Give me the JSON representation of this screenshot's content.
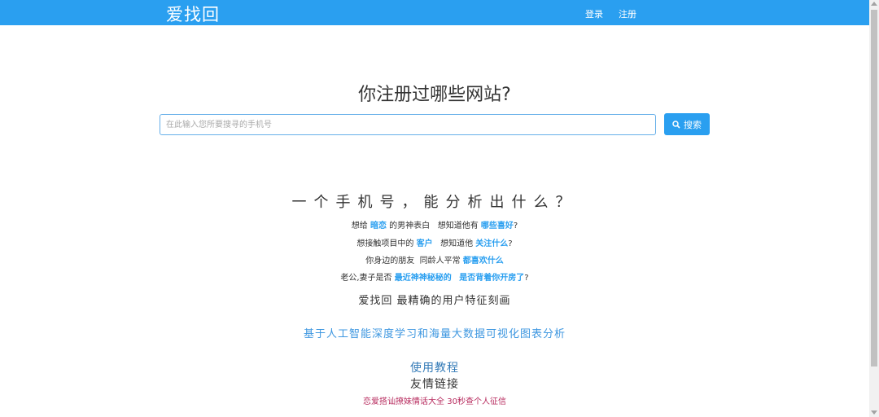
{
  "navbar": {
    "brand": "爱找回",
    "login": "登录",
    "register": "注册",
    "bg_color": "#2a9ff0"
  },
  "search": {
    "headline": "你注册过哪些网站?",
    "placeholder": "在此输入您所要搜寻的手机号",
    "button_label": "搜索",
    "button_icon": "search-icon"
  },
  "intro": {
    "title": "一个手机号，能分析出什么？",
    "line1": {
      "a": "想给",
      "b": "暗恋",
      "c": "的男神表白",
      "d": "想知道他有",
      "e": "哪些喜好",
      "f": "?"
    },
    "line2": {
      "a": "想接触项目中的",
      "b": "客户",
      "c": "想知道他",
      "d": "关注什么",
      "e": "?"
    },
    "line3": {
      "a": "你身边的朋友",
      "b": "同龄人平常",
      "c": "都喜欢什么"
    },
    "line4": {
      "a": "老公,妻子是否",
      "b": "最近神神秘秘的",
      "c": "是否背着你开房了",
      "d": "?"
    },
    "profile": "爱找回 最精确的用户特征刻画",
    "ai_text": "基于人工智能深度学习和海量大数据可视化图表分析"
  },
  "footer": {
    "tutorial": "使用教程",
    "friends_title": "友情链接",
    "links": [
      "恋爱搭讪撩妹情话大全",
      "30秒查个人征信"
    ]
  },
  "colors": {
    "accent": "#2a9ff0",
    "link_red": "#b72b5e"
  }
}
